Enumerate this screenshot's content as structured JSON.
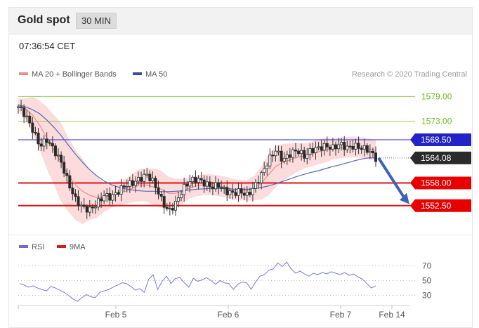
{
  "header": {
    "title": "Gold spot",
    "timeframe": "30 MIN"
  },
  "timestamp": "07:36:54 CET",
  "legend": {
    "ma20": {
      "label": "MA 20 + Bollinger Bands",
      "color": "#f08a8a"
    },
    "ma50": {
      "label": "MA 50",
      "color": "#3a4aa6"
    }
  },
  "credit": "Research © 2020 Trading Central",
  "rsi_legend": {
    "rsi": {
      "label": "RSI",
      "color": "#6b6bd6"
    },
    "ma9": {
      "label": "9MA",
      "color": "#d61c1c"
    }
  },
  "chart_data": [
    {
      "type": "line",
      "title": "Gold spot",
      "ylim": [
        1546.5,
        1583.5
      ],
      "levels": [
        {
          "value": 1579.0,
          "label": "1579.00",
          "kind": "resistance",
          "color": "#8fd14f"
        },
        {
          "value": 1573.0,
          "label": "1573.00",
          "kind": "resistance",
          "color": "#8fd14f"
        },
        {
          "value": 1568.5,
          "label": "1568.50",
          "kind": "pivot",
          "color": "#2828cc"
        },
        {
          "value": 1558.0,
          "label": "1558.00",
          "kind": "support",
          "color": "#e01010"
        },
        {
          "value": 1552.5,
          "label": "1552.50",
          "kind": "support",
          "color": "#e01010"
        }
      ],
      "last_price": {
        "value": 1564.08,
        "label": "1564.08"
      },
      "x_tick_labels": [
        "Feb 5",
        "Feb 6",
        "Feb 7",
        "Feb 14"
      ],
      "price_path": [
        1576.5,
        1574.5,
        1571,
        1567,
        1568.5,
        1566,
        1563,
        1558,
        1554,
        1552,
        1551.5,
        1553,
        1555,
        1554.5,
        1556,
        1557.5,
        1558,
        1559,
        1560,
        1558,
        1554,
        1551,
        1553,
        1556.5,
        1558.5,
        1559,
        1558,
        1557,
        1557.5,
        1556,
        1555.5,
        1556,
        1555,
        1557,
        1560,
        1563.5,
        1566,
        1563.5,
        1565,
        1566,
        1564.5,
        1566,
        1566.5,
        1567,
        1566.5,
        1567.5,
        1566.5,
        1567,
        1566.5,
        1566,
        1564
      ],
      "ma20_path": [
        1577,
        1576,
        1574.5,
        1572,
        1569,
        1566,
        1563,
        1560,
        1557.5,
        1556,
        1555,
        1554.5,
        1554.5,
        1555,
        1555.5,
        1556,
        1556.8,
        1557.5,
        1557.5,
        1557,
        1556.5,
        1555.5,
        1555.5,
        1556,
        1556.8,
        1557.3,
        1557.6,
        1557.6,
        1557.3,
        1557,
        1556.5,
        1556.3,
        1556.2,
        1556.8,
        1558,
        1560,
        1562,
        1563,
        1563.6,
        1564.2,
        1564.6,
        1565,
        1565.6,
        1566,
        1566.2,
        1566.5,
        1566.7,
        1566.8,
        1566.6,
        1566.3,
        1566
      ],
      "ma50_path": [
        1577,
        1576.5,
        1575.8,
        1574.8,
        1573.3,
        1571.5,
        1569.5,
        1567.2,
        1565,
        1563,
        1561.2,
        1559.7,
        1558.5,
        1557.6,
        1557,
        1556.6,
        1556.3,
        1556.1,
        1556,
        1556,
        1555.9,
        1555.9,
        1556,
        1556.1,
        1556.3,
        1556.5,
        1556.6,
        1556.7,
        1556.7,
        1556.6,
        1556.5,
        1556.5,
        1556.5,
        1556.6,
        1556.9,
        1557.3,
        1557.8,
        1558.4,
        1559,
        1559.6,
        1560.1,
        1560.6,
        1561,
        1561.5,
        1562,
        1562.4,
        1562.9,
        1563.4,
        1563.8,
        1564.1,
        1564.1
      ],
      "band_halfwidth": [
        1.5,
        2.5,
        4.5,
        6,
        7.5,
        8.5,
        9.5,
        9,
        8.5,
        8,
        6,
        5,
        3.5,
        3,
        3,
        3,
        3.5,
        4,
        4,
        4.5,
        4.5,
        4,
        3.5,
        3,
        2.5,
        2.5,
        2.5,
        2.5,
        2.5,
        2.5,
        2.5,
        2.5,
        2.5,
        3,
        4,
        5,
        5,
        4.5,
        4,
        3.5,
        3,
        3,
        3,
        3,
        2.5,
        2.5,
        2.5,
        2.5,
        2.5,
        2.5,
        2.5
      ],
      "projection": {
        "from": 1564.08,
        "to": 1552.5
      }
    },
    {
      "type": "line",
      "title": "RSI",
      "ylim": [
        20,
        80
      ],
      "y_tick_labels": [
        "70",
        "50",
        "30"
      ],
      "y_ticks": [
        70,
        50,
        30
      ],
      "series": [
        {
          "name": "RSI",
          "values": [
            46,
            44,
            41,
            43,
            40,
            38,
            36,
            42,
            40,
            37,
            34,
            30,
            25,
            22,
            27,
            31,
            28,
            27,
            34,
            36,
            38,
            41,
            44,
            47,
            46,
            42,
            37,
            39,
            34,
            52,
            58,
            38,
            49,
            56,
            46,
            53,
            54,
            47,
            41,
            53,
            49,
            51,
            54,
            50,
            45,
            50,
            47,
            46,
            38,
            45,
            48,
            47,
            38,
            48,
            56,
            58,
            64,
            66,
            74,
            69,
            75,
            66,
            60,
            63,
            59,
            56,
            60,
            58,
            61,
            59,
            62,
            60,
            58,
            61,
            57,
            59,
            55,
            52,
            46,
            40,
            43
          ]
        }
      ]
    }
  ]
}
